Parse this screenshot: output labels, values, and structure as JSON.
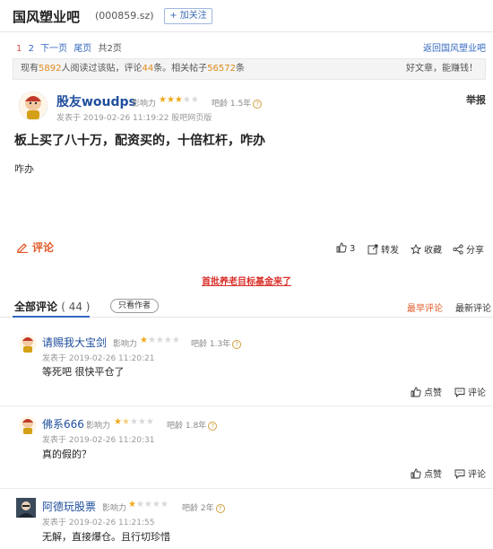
{
  "header": {
    "bar_name": "国风塑业吧",
    "stock_code": "(000859.sz)",
    "follow_label": "+ 加关注"
  },
  "pager": {
    "page1": "1",
    "page2": "2",
    "next": "下一页",
    "last": "尾页",
    "total": "共2页",
    "back_link": "返回国风塑业吧"
  },
  "stats": {
    "prefix": "现有",
    "readers": "5892",
    "mid1": "人阅读过该贴，评论",
    "comments": "44",
    "mid2": "条。相关帖子",
    "related": "56572",
    "suffix": "条",
    "right_text": "好文章，能赚钱！"
  },
  "post": {
    "username": "股友woudps",
    "influence_label": "影响力",
    "stars_on": 3,
    "stars_total": 5,
    "age": "吧龄 1.5年",
    "report": "举报",
    "time": "发表于 2019-02-26 11:19:22 股吧网页版",
    "title": "板上买了八十万，配资买的，十倍杠杆，咋办",
    "body": "咋办",
    "comment_label": "评论",
    "like_count": "3",
    "share_label": "转发",
    "collect_label": "收藏",
    "divide_label": "分享"
  },
  "promo": "首批养老目标基金来了",
  "tabs": {
    "all_label": "全部评论",
    "all_count": "( 44 )",
    "only_author": "只看作者",
    "best": "最早评论",
    "newest": "最新评论"
  },
  "comments": [
    {
      "user": "请赐我大宝剑",
      "influence": "影响力",
      "stars_on": 1,
      "age": "吧龄 1.3年",
      "time": "发表于 2019-02-26 11:20:21",
      "body": "等死吧 很快平仓了",
      "like": "点赞",
      "reply": "评论"
    },
    {
      "user": "佛系666",
      "influence": "影响力",
      "stars_on": 1.5,
      "age": "吧龄 1.8年",
      "time": "发表于 2019-02-26 11:20:31",
      "body": "真的假的？",
      "like": "点赞",
      "reply": "评论"
    },
    {
      "user": "阿德玩股票",
      "influence": "影响力",
      "stars_on": 1,
      "age": "吧龄 2年",
      "time": "发表于 2019-02-26 11:21:55",
      "body": "无解，直接爆仓。且行切珍惜"
    }
  ],
  "colors": {
    "link_blue": "#3468c0",
    "username_blue": "#1f4e9c",
    "orange_accent": "#e05a2a",
    "star_gold": "#f0a81a",
    "promo_red": "#d9302a"
  }
}
